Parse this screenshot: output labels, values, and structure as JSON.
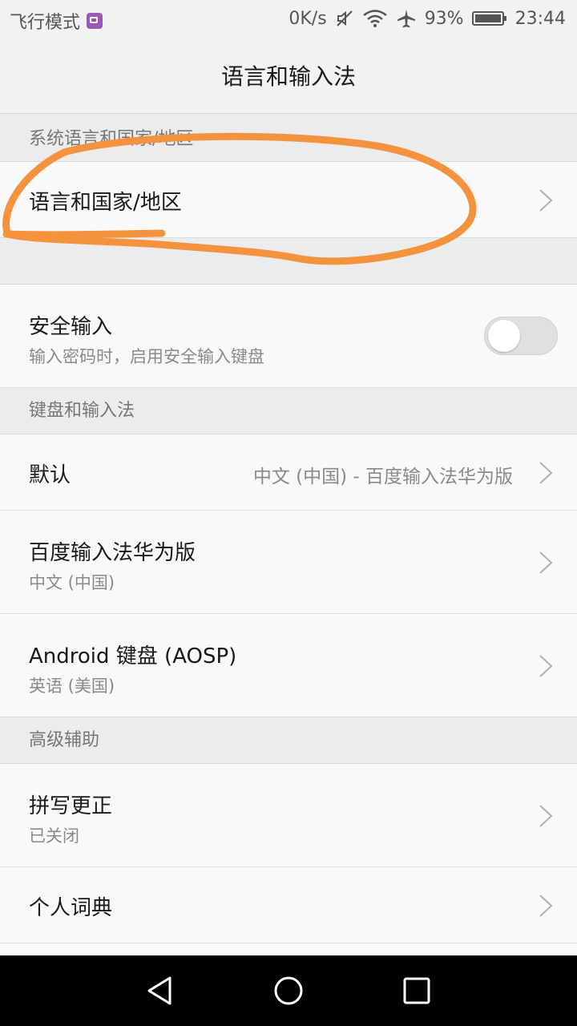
{
  "status_bar": {
    "mode_text": "飞行模式",
    "speed": "0K/s",
    "battery": "93%",
    "time": "23:44"
  },
  "title": "语言和输入法",
  "sections": {
    "system_language_header": "系统语言和国家/地区",
    "keyboard_header": "键盘和输入法",
    "advanced_header": "高级辅助"
  },
  "rows": {
    "language_region": {
      "label": "语言和国家/地区"
    },
    "secure_input": {
      "label": "安全输入",
      "subtitle": "输入密码时，启用安全输入键盘"
    },
    "default": {
      "label": "默认",
      "value": "中文 (中国) - 百度输入法华为版"
    },
    "baidu": {
      "label": "百度输入法华为版",
      "subtitle": "中文 (中国)"
    },
    "android_keyboard": {
      "label": "Android 键盘 (AOSP)",
      "subtitle": "英语 (美国)"
    },
    "spell_check": {
      "label": "拼写更正",
      "subtitle": "已关闭"
    },
    "personal_dictionary": {
      "label": "个人词典"
    }
  },
  "icons": {
    "status": [
      "gallery-icon",
      "mute-icon",
      "wifi-icon",
      "airplane-icon",
      "battery-icon"
    ],
    "nav": [
      "back-icon",
      "home-icon",
      "recents-icon"
    ],
    "row": "chevron-right-icon"
  },
  "colors": {
    "annotation": "#f5923e",
    "gallery_badge": "#9b59b6"
  },
  "secure_input_enabled": false
}
